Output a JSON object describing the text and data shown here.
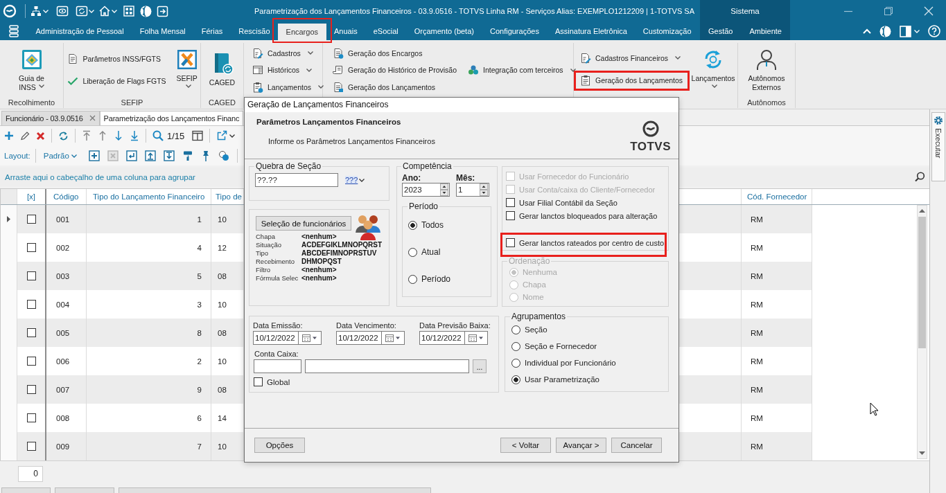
{
  "title_bar": {
    "title": "Parametrização dos Lançamentos Financeiros - 03.9.0516 - TOTVS Linha RM - Serviços  Alias: EXEMPLO1212209 | 1-TOTVS SA",
    "context_label": "Sistema"
  },
  "menu": {
    "tabs": [
      {
        "label": "Administração de Pessoal",
        "kind": "main",
        "selected": false,
        "highlighted": false
      },
      {
        "label": "Folha Mensal",
        "kind": "main",
        "selected": false,
        "highlighted": false
      },
      {
        "label": "Férias",
        "kind": "main",
        "selected": false,
        "highlighted": false
      },
      {
        "label": "Rescisão",
        "kind": "main",
        "selected": false,
        "highlighted": false
      },
      {
        "label": "Encargos",
        "kind": "main",
        "selected": true,
        "highlighted": true
      },
      {
        "label": "Anuais",
        "kind": "main",
        "selected": false,
        "highlighted": false
      },
      {
        "label": "eSocial",
        "kind": "main",
        "selected": false,
        "highlighted": false
      },
      {
        "label": "Orçamento (beta)",
        "kind": "main",
        "selected": false,
        "highlighted": false
      },
      {
        "label": "Configurações",
        "kind": "main",
        "selected": false,
        "highlighted": false
      },
      {
        "label": "Assinatura Eletrônica",
        "kind": "main",
        "selected": false,
        "highlighted": false
      },
      {
        "label": "Customização",
        "kind": "main",
        "selected": false,
        "highlighted": false
      },
      {
        "label": "Gestão",
        "kind": "context",
        "selected": false,
        "highlighted": false
      },
      {
        "label": "Ambiente",
        "kind": "context",
        "selected": false,
        "highlighted": false
      }
    ]
  },
  "ribbon": {
    "groups": [
      {
        "label": "Recolhimento",
        "columns": [
          [
            {
              "kind": "large",
              "label": "Guia de INSS",
              "dropdown": true,
              "highlighted": false
            }
          ]
        ]
      },
      {
        "label": "SEFIP",
        "columns": [
          [
            {
              "kind": "small",
              "label": "Parâmetros INSS/FGTS",
              "dropdown": false,
              "highlighted": false
            },
            {
              "kind": "small",
              "label": "Liberação de Flags FGTS",
              "dropdown": false,
              "highlighted": false
            }
          ],
          [
            {
              "kind": "large",
              "label": "SEFIP",
              "dropdown": true,
              "highlighted": false
            }
          ]
        ]
      },
      {
        "label": "CAGED",
        "columns": [
          [
            {
              "kind": "large",
              "label": "CAGED",
              "dropdown": false,
              "highlighted": false
            }
          ]
        ]
      },
      {
        "columns": [
          [
            {
              "kind": "small",
              "label": "Cadastros",
              "dropdown": true,
              "highlighted": false
            },
            {
              "kind": "small",
              "label": "Históricos",
              "dropdown": true,
              "highlighted": false
            },
            {
              "kind": "small",
              "label": "Lançamentos",
              "dropdown": true,
              "highlighted": false
            }
          ]
        ]
      },
      {
        "columns": [
          [
            {
              "kind": "small",
              "label": "Geração dos Encargos",
              "dropdown": false,
              "highlighted": false
            },
            {
              "kind": "small",
              "label": "Geração do Histórico de Provisão",
              "dropdown": false,
              "highlighted": false
            },
            {
              "kind": "small",
              "label": "Geração dos Lançamentos",
              "dropdown": false,
              "highlighted": false
            }
          ],
          [
            {
              "kind": "small",
              "label": "Integração com terceiros",
              "dropdown": true,
              "highlighted": false
            }
          ]
        ]
      },
      {
        "columns": [
          [
            {
              "kind": "small",
              "label": "Cadastros Financeiros",
              "dropdown": true,
              "highlighted": false
            },
            {
              "kind": "small",
              "label": "Geração dos Lançamentos",
              "dropdown": false,
              "highlighted": true
            }
          ],
          [
            {
              "kind": "large",
              "label": "Lançamentos",
              "dropdown": true,
              "highlighted": false
            }
          ]
        ]
      },
      {
        "label": "Autônomos",
        "columns": [
          [
            {
              "kind": "large",
              "label": "Autônomos Externos",
              "dropdown": false,
              "highlighted": false
            }
          ]
        ]
      }
    ]
  },
  "document_tabs": [
    {
      "label": "Funcionário - 03.9.0516",
      "selected": false,
      "closable": true
    },
    {
      "label": "Parametrização dos Lançamentos Financ",
      "selected": true,
      "closable": false
    }
  ],
  "side_panel": {
    "label": "Executar"
  },
  "grid_toolbar": {
    "record_counter": "1/15",
    "layout_label": "Layout:",
    "layout_value": "Padrão"
  },
  "group_panel": {
    "hint": "Arraste aqui o cabeçalho de uma coluna para agrupar"
  },
  "grid": {
    "columns": [
      "[x]",
      "Código",
      "Tipo do Lançamento Financeiro",
      "Tipo de",
      "Cód. Fornecedor"
    ],
    "rows": [
      {
        "current": true,
        "checked": false,
        "codigo": "001",
        "tipo_lancamento": "1",
        "column_4": "10",
        "fornecedor": "RM"
      },
      {
        "current": false,
        "checked": false,
        "codigo": "002",
        "tipo_lancamento": "4",
        "column_4": "12",
        "fornecedor": "RM"
      },
      {
        "current": false,
        "checked": false,
        "codigo": "003",
        "tipo_lancamento": "5",
        "column_4": "08",
        "fornecedor": "RM"
      },
      {
        "current": false,
        "checked": false,
        "codigo": "004",
        "tipo_lancamento": "3",
        "column_4": "10",
        "fornecedor": "RM"
      },
      {
        "current": false,
        "checked": false,
        "codigo": "005",
        "tipo_lancamento": "8",
        "column_4": "08",
        "fornecedor": "RM"
      },
      {
        "current": false,
        "checked": false,
        "codigo": "006",
        "tipo_lancamento": "2",
        "column_4": "10",
        "fornecedor": "RM"
      },
      {
        "current": false,
        "checked": false,
        "codigo": "007",
        "tipo_lancamento": "9",
        "column_4": "08",
        "fornecedor": "RM"
      },
      {
        "current": false,
        "checked": false,
        "codigo": "008",
        "tipo_lancamento": "6",
        "column_4": "14",
        "fornecedor": "RM"
      },
      {
        "current": false,
        "checked": false,
        "codigo": "009",
        "tipo_lancamento": "7",
        "column_4": "10",
        "fornecedor": "RM"
      }
    ]
  },
  "footer": {
    "count": "0"
  },
  "dialog": {
    "title": "Geração de Lançamentos Financeiros",
    "heading": "Parâmetros Lançamentos Financeiros",
    "subheading": "Informe os Parâmetros Lançamentos Financeiros",
    "logo_text": "TOTVS",
    "section_break": {
      "legend": "Quebra de Seção",
      "value": "??.??",
      "mask_button": "???"
    },
    "employee_selection": {
      "button": "Seleção de funcionários",
      "fields": [
        {
          "label": "Chapa",
          "value": "<nenhum>"
        },
        {
          "label": "Situação",
          "value": "ACDEFGIKLMNOPQRST"
        },
        {
          "label": "Tipo",
          "value": "ABCDEFIMNOPRSTUV"
        },
        {
          "label": "Recebimento",
          "value": "DHMOPQST"
        },
        {
          "label": "Filtro",
          "value": "<nenhum>"
        },
        {
          "label": "Fórmula Selec",
          "value": "<nenhum>"
        }
      ]
    },
    "competencia": {
      "legend": "Competência",
      "year_label": "Ano:",
      "year": "2023",
      "month_label": "Mês:",
      "month": "1"
    },
    "periodo": {
      "legend": "Período",
      "options": [
        {
          "label": "Todos",
          "selected": true
        },
        {
          "label": "Atual",
          "selected": false
        },
        {
          "label": "Período",
          "selected": false
        }
      ]
    },
    "options": [
      {
        "label": "Usar Fornecedor do Funcionário",
        "checked": false,
        "disabled": true,
        "highlighted": false
      },
      {
        "label": "Usar Conta/caixa do Cliente/Fornecedor",
        "checked": false,
        "disabled": true,
        "highlighted": false
      },
      {
        "label": "Usar Filial Contábil da Seção",
        "checked": false,
        "disabled": false,
        "highlighted": false
      },
      {
        "label": "Gerar lanctos bloqueados para alteração",
        "checked": false,
        "disabled": false,
        "highlighted": false
      },
      {
        "label": "Gerar lanctos rateados por centro de custo",
        "checked": false,
        "disabled": false,
        "highlighted": true
      }
    ],
    "ordenacao": {
      "legend": "Ordenação",
      "disabled": true,
      "options": [
        {
          "label": "Nenhuma",
          "selected": true
        },
        {
          "label": "Chapa",
          "selected": false
        },
        {
          "label": "Nome",
          "selected": false
        }
      ]
    },
    "dates": [
      {
        "label": "Data Emissão:",
        "value": "10/12/2022"
      },
      {
        "label": "Data Vencimento:",
        "value": "10/12/2022"
      },
      {
        "label": "Data Previsão Baixa:",
        "value": "10/12/2022"
      }
    ],
    "conta_caixa": {
      "label": "Conta Caixa:",
      "browse_button": "..."
    },
    "global": {
      "label": "Global",
      "checked": false
    },
    "agrupamentos": {
      "legend": "Agrupamentos",
      "options": [
        {
          "label": "Seção",
          "selected": false
        },
        {
          "label": "Seção e Fornecedor",
          "selected": false
        },
        {
          "label": "Individual por Funcionário",
          "selected": false
        },
        {
          "label": "Usar Parametrização",
          "selected": true
        }
      ]
    },
    "footer_buttons": {
      "left": [
        "Opções"
      ],
      "right": [
        "< Voltar",
        "Avançar >",
        "Cancelar"
      ]
    }
  }
}
